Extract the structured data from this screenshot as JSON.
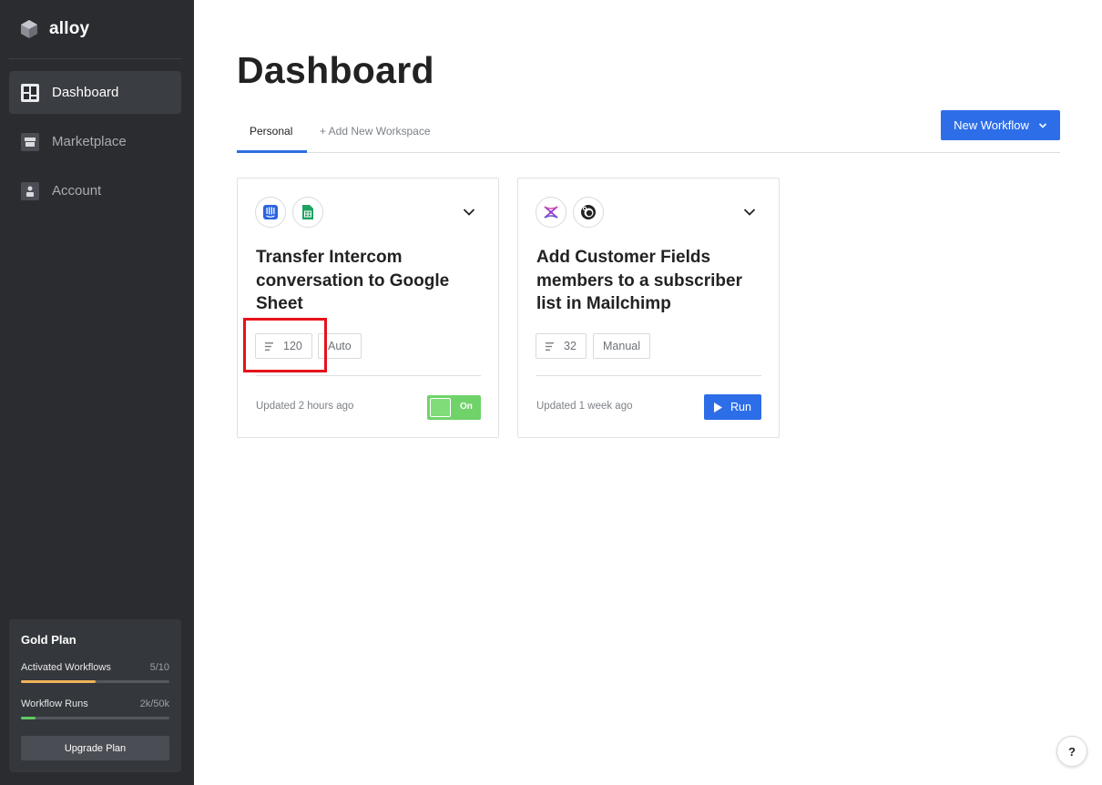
{
  "brand": {
    "name": "alloy"
  },
  "sidebar": {
    "items": [
      {
        "label": "Dashboard",
        "icon": "dashboard-icon",
        "active": true
      },
      {
        "label": "Marketplace",
        "icon": "store-icon",
        "active": false
      },
      {
        "label": "Account",
        "icon": "user-icon",
        "active": false
      }
    ],
    "plan": {
      "title": "Gold Plan",
      "metrics": [
        {
          "label": "Activated Workflows",
          "value": "5/10",
          "progress": 0.5,
          "color": "#f0b35a"
        },
        {
          "label": "Workflow Runs",
          "value": "2k/50k",
          "progress": 0.1,
          "color": "#62c963"
        }
      ],
      "upgrade_label": "Upgrade Plan"
    }
  },
  "main": {
    "title": "Dashboard",
    "tabs": [
      {
        "label": "Personal",
        "active": true
      },
      {
        "label": "+ Add New Workspace",
        "active": false
      }
    ],
    "new_workflow_label": "New Workflow",
    "cards": [
      {
        "apps": [
          "intercom-icon",
          "google-sheets-icon"
        ],
        "title": "Transfer Intercom conversation to Google Sheet",
        "count": "120",
        "mode": "Auto",
        "updated": "Updated 2 hours ago",
        "action": {
          "type": "toggle",
          "label": "On",
          "state": true
        }
      },
      {
        "apps": [
          "customer-fields-icon",
          "mailchimp-icon"
        ],
        "title": "Add Customer Fields members to a subscriber list in Mailchimp",
        "count": "32",
        "mode": "Manual",
        "updated": "Updated 1 week ago",
        "action": {
          "type": "button",
          "label": "Run"
        }
      }
    ]
  },
  "help": {
    "label": "?"
  },
  "colors": {
    "accent": "#2d6ee8",
    "toggle_on": "#6fd36a",
    "sidebar": "#2a2c30",
    "highlight": "#e5121b"
  }
}
